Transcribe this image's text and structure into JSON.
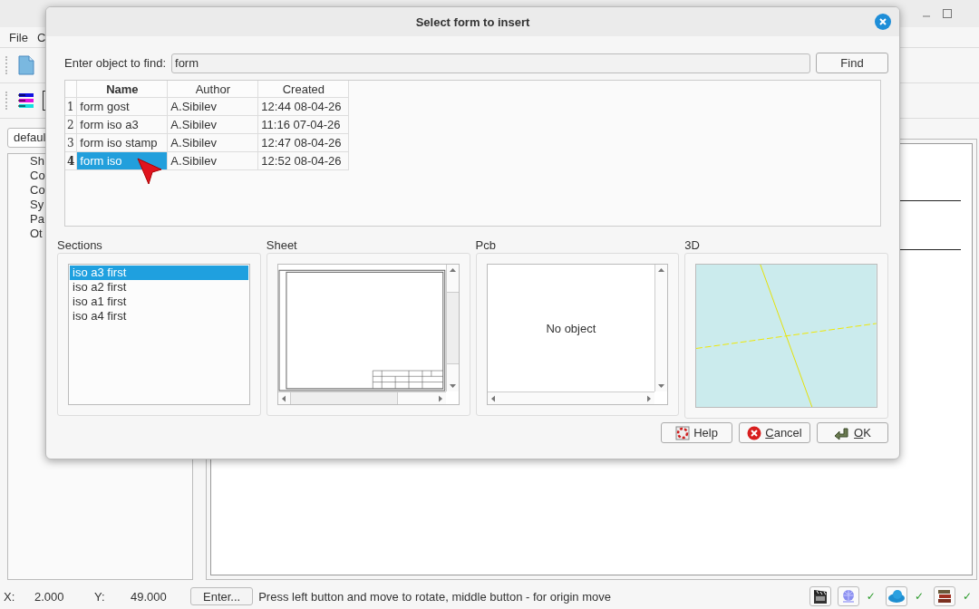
{
  "background_window": {
    "menu": [
      "File",
      "C"
    ],
    "combo_value": "defaul",
    "tree_items": [
      "Sh",
      "Co",
      "Co",
      "Sy",
      "Pa",
      "Ot"
    ]
  },
  "dialog": {
    "title": "Select form to insert",
    "search": {
      "label": "Enter object to find:",
      "value": "form"
    },
    "find_button": "Find",
    "table": {
      "columns": [
        "Name",
        "Author",
        "Created"
      ],
      "rows": [
        {
          "index": "1",
          "name": "form gost",
          "author": "A.Sibilev",
          "created": "12:44 08-04-26",
          "selected": false
        },
        {
          "index": "2",
          "name": "form iso a3",
          "author": "A.Sibilev",
          "created": "11:16 07-04-26",
          "selected": false
        },
        {
          "index": "3",
          "name": "form iso stamp",
          "author": "A.Sibilev",
          "created": "12:47 08-04-26",
          "selected": false
        },
        {
          "index": "4",
          "name": "form iso",
          "author": "A.Sibilev",
          "created": "12:52 08-04-26",
          "selected": true
        }
      ]
    },
    "panels": [
      {
        "kind": "list",
        "title": "Sections",
        "items": [
          {
            "label": "iso a3 first",
            "selected": true
          },
          {
            "label": "iso a2 first",
            "selected": false
          },
          {
            "label": "iso a1 first",
            "selected": false
          },
          {
            "label": "iso a4 first",
            "selected": false
          }
        ]
      },
      {
        "kind": "sheet",
        "title": "Sheet"
      },
      {
        "kind": "pcb",
        "title": "Pcb",
        "message": "No object"
      },
      {
        "kind": "view3d",
        "title": "3D"
      }
    ],
    "buttons": [
      {
        "kind": "help",
        "label": "Help",
        "mnemonic": false
      },
      {
        "kind": "cancel",
        "label": "Cancel",
        "mnemonic": true
      },
      {
        "kind": "ok",
        "label": "OK",
        "mnemonic": true
      }
    ]
  },
  "status_bar": {
    "x_label": "X:",
    "x_value": "2.000",
    "y_label": "Y:",
    "y_value": "49.000",
    "enter_button": "Enter...",
    "message": "Press left button and move to rotate, middle button - for origin move",
    "indicators": [
      {
        "kind": "clapper"
      },
      {
        "kind": "globe",
        "check": "✓"
      },
      {
        "kind": "cloud",
        "check": "✓"
      },
      {
        "kind": "books",
        "check": "✓"
      }
    ]
  }
}
